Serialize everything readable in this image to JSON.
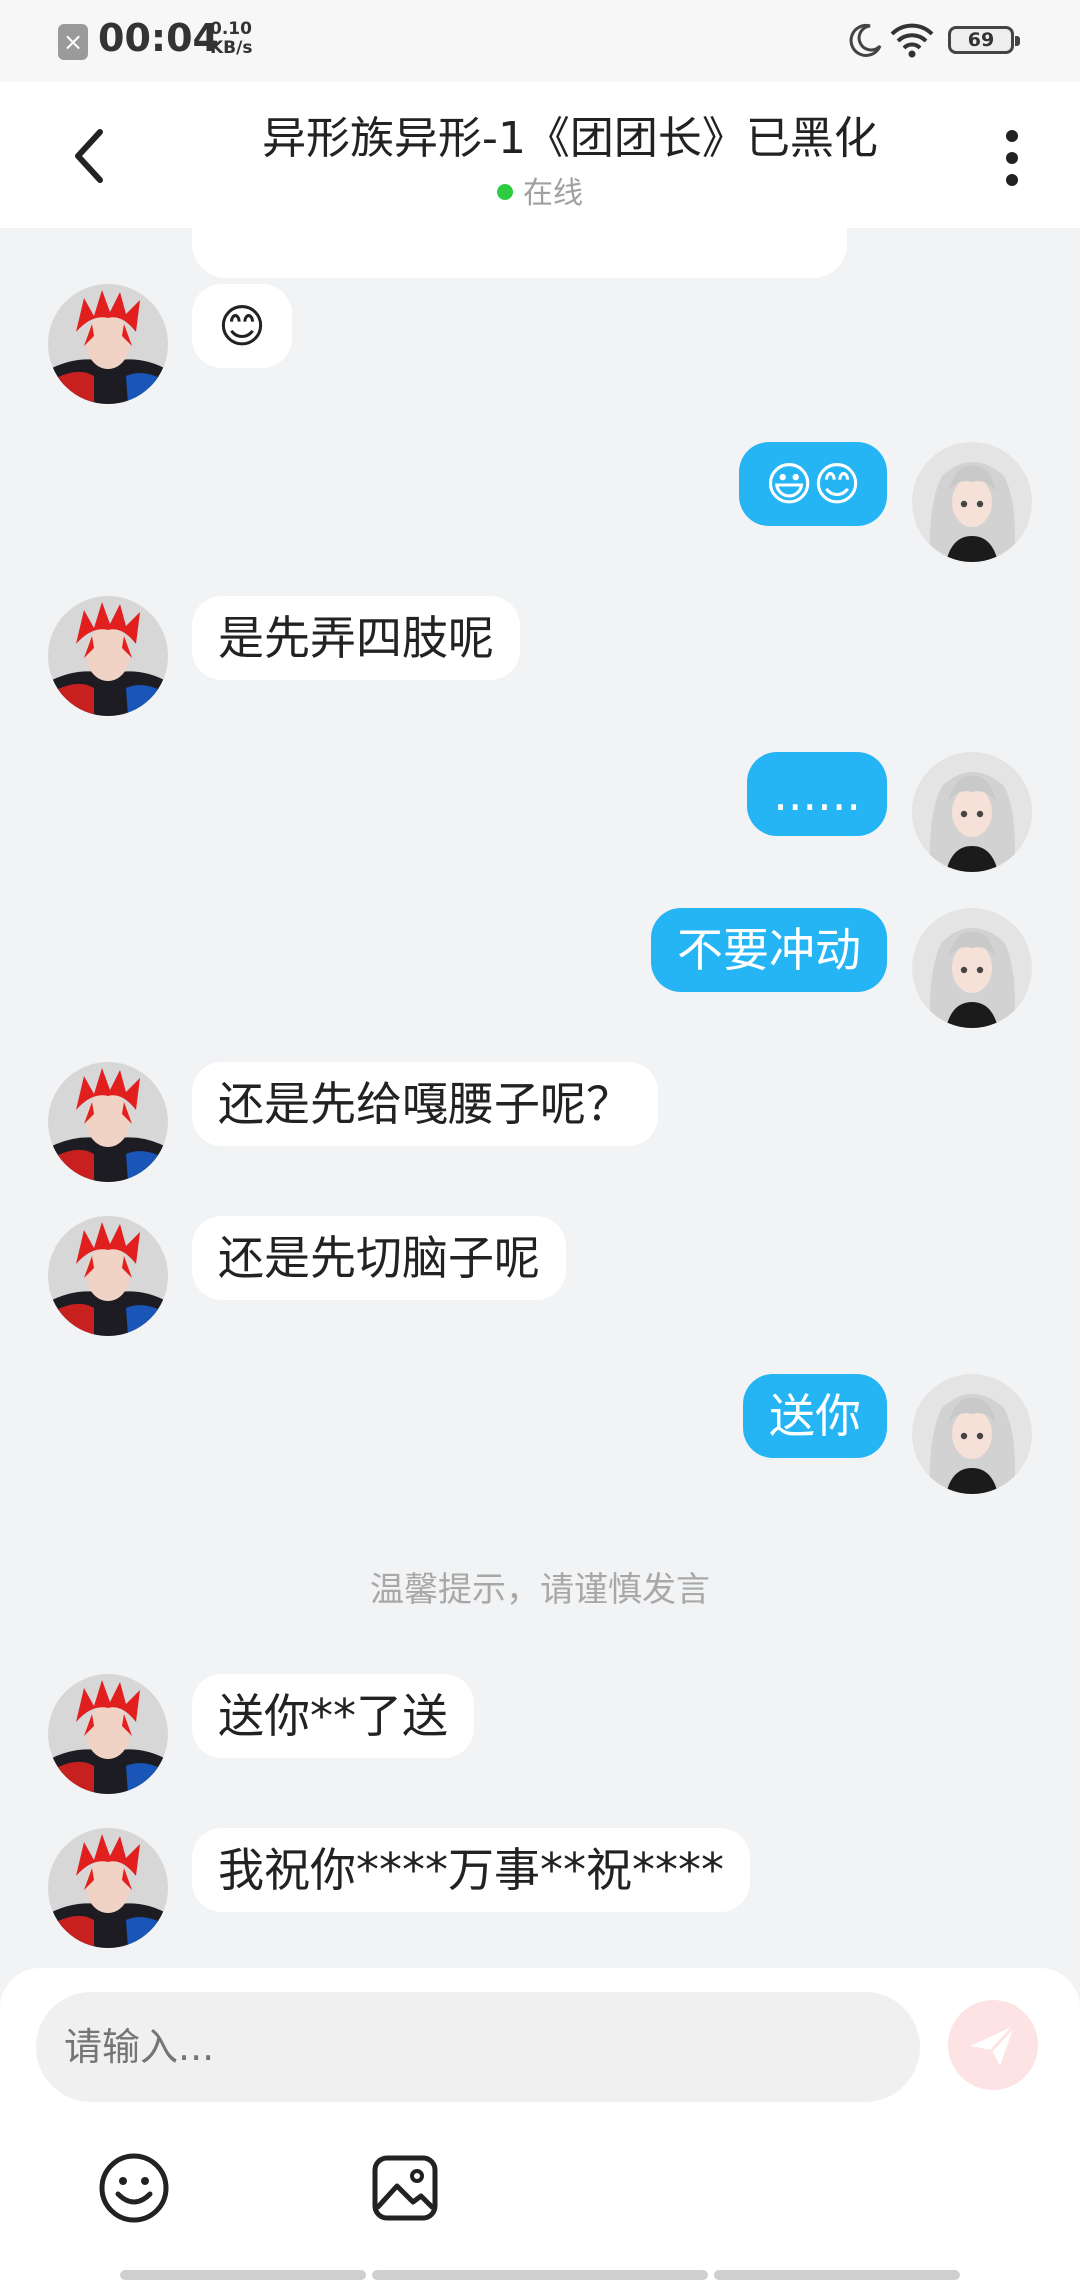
{
  "status_bar": {
    "time": "00:04",
    "speed_value": "0.10",
    "speed_unit": "KB/s",
    "battery": "69"
  },
  "header": {
    "title": "异形族异形-1《团团长》已黑化",
    "status": "在线"
  },
  "messages": [
    {
      "side": "left",
      "text": "😊"
    },
    {
      "side": "right",
      "text": "😃😊"
    },
    {
      "side": "left",
      "text": "是先弄四肢呢"
    },
    {
      "side": "right",
      "text": "......"
    },
    {
      "side": "right",
      "text": "不要冲动"
    },
    {
      "side": "left",
      "text": "还是先给嘎腰子呢？"
    },
    {
      "side": "left",
      "text": "还是先切脑子呢"
    },
    {
      "side": "right",
      "text": "送你"
    },
    {
      "side": "left",
      "text": "送你**了送"
    },
    {
      "side": "left",
      "text": "我祝你****万事**祝****"
    }
  ],
  "notice": "温馨提示，请谨慎发言",
  "input": {
    "placeholder": "请输入..."
  },
  "colors": {
    "outgoing_bubble": "#26b5f4",
    "incoming_bubble": "#ffffff",
    "online_dot": "#2ecc40",
    "send_button": "#fde3e3"
  },
  "icons": [
    "back-arrow-icon",
    "more-vertical-icon",
    "emoji-icon",
    "image-icon",
    "send-icon"
  ]
}
